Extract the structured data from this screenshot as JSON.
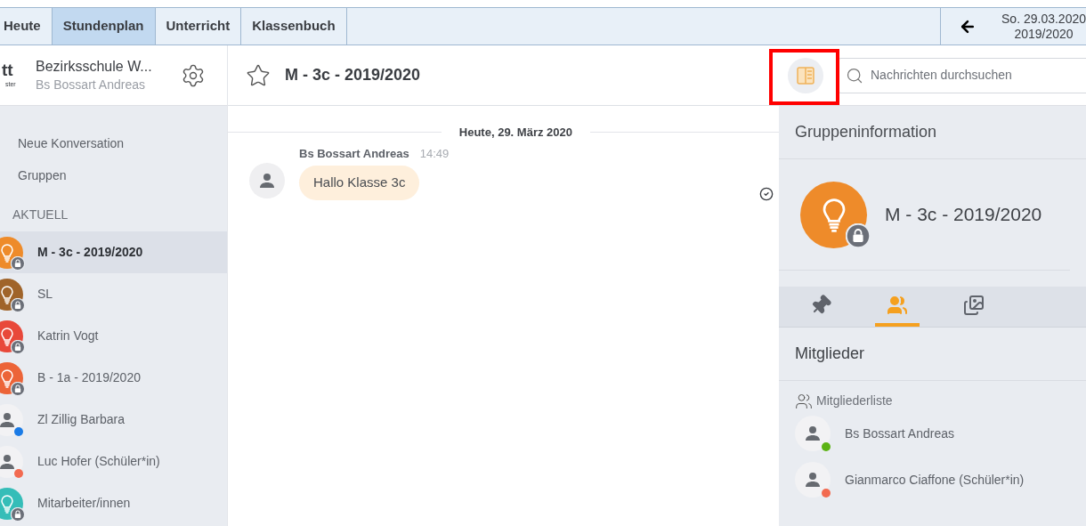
{
  "top_tabs": [
    {
      "label": "Heute",
      "selected": false
    },
    {
      "label": "Stundenplan",
      "selected": true
    },
    {
      "label": "Unterricht",
      "selected": false
    },
    {
      "label": "Klassenbuch",
      "selected": false
    }
  ],
  "date": {
    "day": "So. 29.03.2020",
    "year": "2019/2020"
  },
  "school": {
    "logo": "tt",
    "logo_sub": "ster",
    "name": "Bezirksschule W...",
    "user": "Bs Bossart Andreas"
  },
  "sidebar": {
    "actions": [
      "Neue Konversation",
      "Gruppen"
    ],
    "section": "AKTUELL",
    "conversations": [
      {
        "name": "M - 3c - 2019/2020",
        "kind": "group",
        "color": "#ee8b2a",
        "selected": true
      },
      {
        "name": "SL",
        "kind": "group",
        "color": "#a0642a",
        "selected": false
      },
      {
        "name": "Katrin Vogt",
        "kind": "group",
        "color": "#e8483a",
        "selected": false
      },
      {
        "name": "B - 1a - 2019/2020",
        "kind": "group",
        "color": "#ec6438",
        "selected": false
      },
      {
        "name": "Zl Zillig Barbara",
        "kind": "person",
        "color": "#1a7be6",
        "selected": false
      },
      {
        "name": "Luc Hofer (Schüler*in)",
        "kind": "person",
        "color": "#f26a50",
        "selected": false
      },
      {
        "name": "Mitarbeiter/innen",
        "kind": "group",
        "color": "#35bdb8",
        "selected": false
      }
    ]
  },
  "chat": {
    "title": "M - 3c - 2019/2020",
    "starred": false,
    "day": "Heute, 29. März 2020",
    "messages": [
      {
        "sender": "Bs Bossart Andreas",
        "time": "14:49",
        "text": "Hallo Klasse 3c",
        "read": true
      }
    ]
  },
  "search": {
    "placeholder": "Nachrichten durchsuchen"
  },
  "info": {
    "title": "Gruppeninformation",
    "group": {
      "name": "M - 3c - 2019/2020",
      "color": "#ee8b2a"
    },
    "tabs": [
      {
        "kind": "pin",
        "selected": false
      },
      {
        "kind": "members",
        "selected": true
      },
      {
        "kind": "media",
        "selected": false
      }
    ],
    "section": "Mitglieder",
    "list_label": "Mitgliederliste",
    "members": [
      {
        "name": "Bs Bossart Andreas",
        "color": "#5cb314"
      },
      {
        "name": "Gianmarco Ciaffone (Schüler*in)",
        "color": "#f26a50"
      }
    ]
  }
}
